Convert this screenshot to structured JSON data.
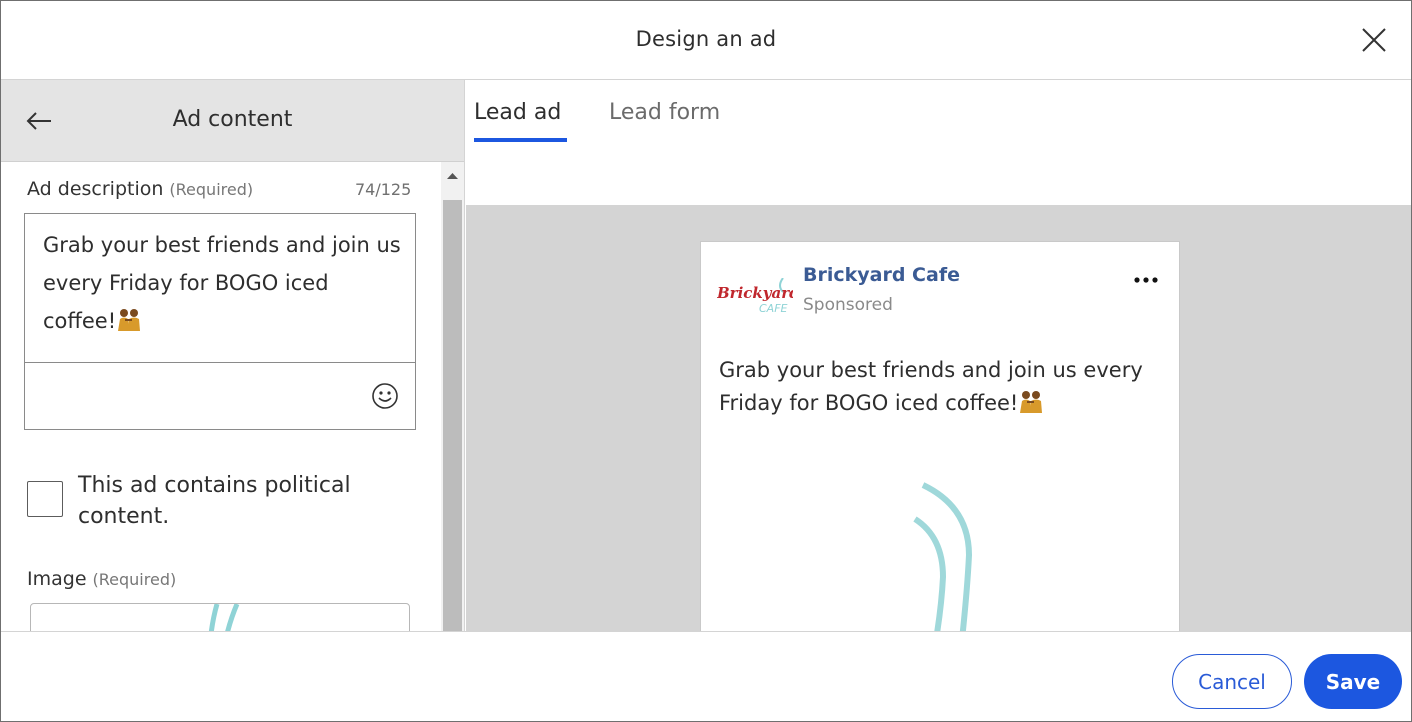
{
  "dialog": {
    "title": "Design an ad"
  },
  "left_panel": {
    "title": "Ad content",
    "description": {
      "label": "Ad description",
      "required": "(Required)",
      "counter": "74/125",
      "text": "Grab your best friends and join us every Friday for BOGO iced coffee!"
    },
    "political": {
      "label": "This ad contains political content.",
      "checked": false
    },
    "image": {
      "label": "Image",
      "required": "(Required)"
    }
  },
  "tabs": [
    {
      "label": "Lead ad",
      "active": true
    },
    {
      "label": "Lead form",
      "active": false
    }
  ],
  "preview": {
    "brand_name": "Brickyard Cafe",
    "sponsored": "Sponsored",
    "logo_text_top": "Brickyard",
    "logo_text_bottom": "CAFE",
    "text": "Grab your best friends and join us every Friday for BOGO iced coffee!"
  },
  "footer": {
    "cancel_label": "Cancel",
    "save_label": "Save"
  },
  "colors": {
    "accent": "#1c57e0",
    "brand_link": "#3b5b94",
    "logo_red": "#c0272d",
    "logo_teal": "#8fd3d6"
  },
  "icons": {
    "close": "close-icon",
    "back": "arrow-left-icon",
    "emoji": "smiley-icon",
    "more": "more-horizontal-icon",
    "friends_emoji": "two-people-emoji"
  }
}
